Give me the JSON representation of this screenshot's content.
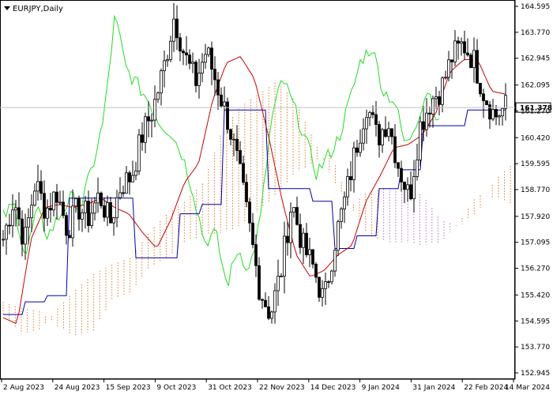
{
  "chart_data": {
    "type": "candlestick",
    "symbol_label": "EURJPY,Daily",
    "current_price": 161.378,
    "current_price_label": "161.378",
    "y_axis": {
      "min": 152.945,
      "max": 164.595,
      "ticks": [
        "164.595",
        "163.770",
        "162.945",
        "162.095",
        "161.270",
        "160.420",
        "159.595",
        "158.770",
        "157.920",
        "157.095",
        "156.270",
        "155.420",
        "154.595",
        "153.770",
        "152.945"
      ]
    },
    "x_axis": {
      "ticks": [
        {
          "label": "2 Aug 2023",
          "date": "2023-08-02"
        },
        {
          "label": "24 Aug 2023",
          "date": "2023-08-24"
        },
        {
          "label": "15 Sep 2023",
          "date": "2023-09-15"
        },
        {
          "label": "9 Oct 2023",
          "date": "2023-10-09"
        },
        {
          "label": "31 Oct 2023",
          "date": "2023-10-31"
        },
        {
          "label": "22 Nov 2023",
          "date": "2023-11-22"
        },
        {
          "label": "14 Dec 2023",
          "date": "2023-12-14"
        },
        {
          "label": "9 Jan 2024",
          "date": "2024-01-09"
        },
        {
          "label": "31 Jan 2024",
          "date": "2024-01-31"
        },
        {
          "label": "22 Feb 2024",
          "date": "2024-02-22"
        },
        {
          "label": "14 Mar 2024",
          "date": "2024-03-14"
        }
      ]
    },
    "indicators": {
      "tenkan_color": "#cc0000",
      "kijun_color": "#0000aa",
      "chikou_color": "#22dd22",
      "cloud_bull_color": "#e07828",
      "cloud_bear_color": "#b070c0"
    },
    "ohlc_key_points": [
      157.2,
      158.5,
      157.1,
      159.0,
      158.1,
      158.7,
      157.5,
      158.2,
      157.9,
      158.6,
      157.7,
      158.9,
      159.2,
      160.5,
      161.3,
      162.6,
      164.3,
      163.0,
      162.2,
      163.2,
      162.1,
      161.0,
      159.5,
      157.6,
      155.6,
      154.8,
      156.2,
      158.4,
      157.0,
      156.3,
      155.2,
      157.1,
      158.5,
      160.1,
      161.5,
      160.4,
      161.0,
      159.5,
      158.5,
      160.8,
      161.6,
      162.0,
      163.0,
      163.4,
      162.9,
      161.8,
      161.1,
      161.4
    ],
    "tenkan_key_points": [
      154.7,
      154.5,
      157.2,
      158.2,
      158.3,
      158.2,
      158.3,
      158.5,
      158.2,
      158.0,
      157.4,
      156.9,
      157.8,
      159.0,
      159.6,
      161.6,
      162.8,
      163.0,
      162.3,
      160.5,
      158.4,
      156.7,
      156.0,
      156.2,
      156.7,
      157.0,
      158.4,
      159.2,
      160.1,
      160.2,
      160.5,
      161.2,
      162.5,
      162.9,
      162.9,
      161.9,
      161.8
    ],
    "kijun_key_points": [
      154.8,
      155.2,
      155.4,
      158.5,
      158.5,
      158.5,
      156.6,
      156.6,
      158.0,
      158.3,
      161.3,
      161.3,
      158.8,
      158.8,
      158.4,
      156.9,
      157.3,
      158.8,
      159.4,
      160.8,
      160.8,
      161.3,
      161.3
    ],
    "chikou_key_points": [
      157.9,
      158.3,
      156.6,
      158.1,
      157.3,
      157.9,
      158.5,
      158.3,
      159.5,
      161.0,
      164.3,
      162.6,
      162.1,
      161.6,
      160.9,
      160.6,
      159.9,
      158.7,
      157.1,
      157.4,
      155.7,
      156.9,
      156.2,
      157.8,
      161.0,
      162.3,
      161.4,
      160.4,
      159.3,
      159.8,
      160.4,
      161.6,
      162.9,
      163.3,
      161.9,
      161.6,
      160.1,
      161.0,
      162.0,
      160.8
    ],
    "grid": false,
    "legend": "none"
  }
}
